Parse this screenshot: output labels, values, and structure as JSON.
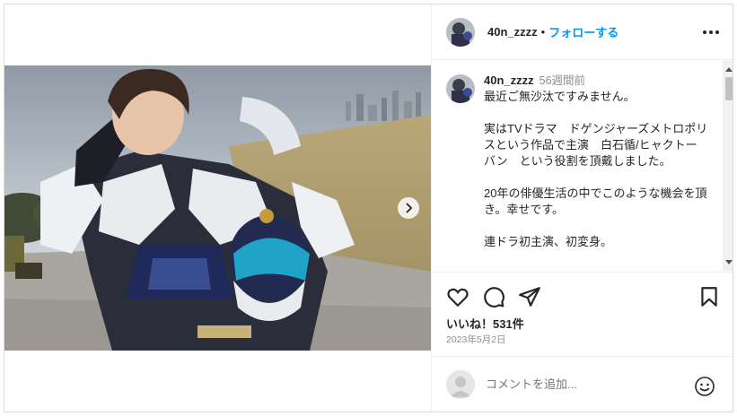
{
  "post": {
    "username": "40n_zzzz",
    "separator": "•",
    "follow_label": "フォローする",
    "more_icon": "more-options-icon",
    "next_icon": "chevron-right-icon"
  },
  "caption": {
    "username": "40n_zzzz",
    "time": "56週間前",
    "text": "最近ご無沙汰ですみません。\n\n実はTVドラマ　ドゲンジャーズメトロポリスという作品で主演　白石循/ヒャクトーバン　という役割を頂戴しました。\n\n20年の俳優生活の中でこのような機会を頂き。幸せです。\n\n連ドラ初主演、初変身。"
  },
  "actions": {
    "icons": [
      "heart-icon",
      "comment-icon",
      "share-icon",
      "save-icon"
    ],
    "likes_label": "いいね！531件",
    "date": "2023年5月2日"
  },
  "add_comment": {
    "placeholder": "コメントを追加...",
    "emoji_icon": "emoji-icon"
  },
  "colors": {
    "accent": "#0095f6",
    "text": "#262626",
    "muted": "#8e8e8e",
    "border": "#dbdbdb"
  }
}
